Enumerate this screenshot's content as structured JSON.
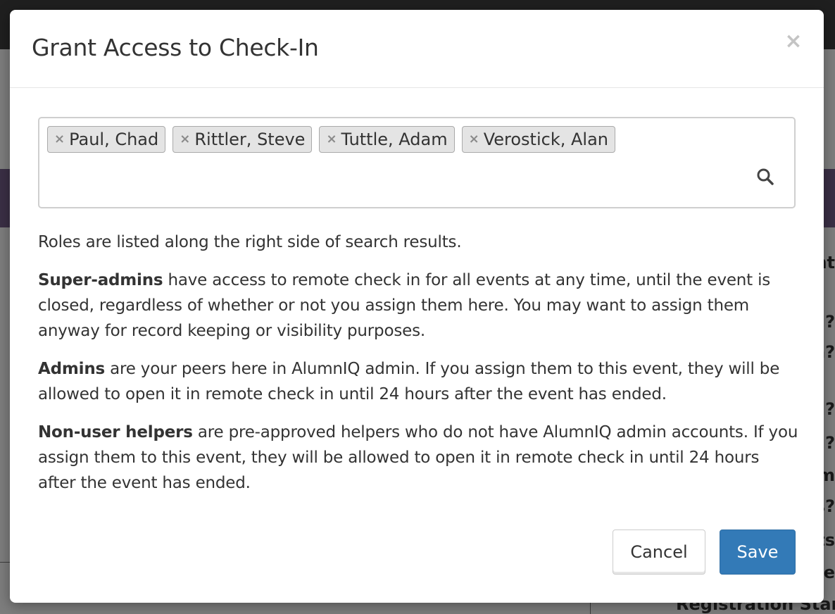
{
  "modal": {
    "title": "Grant Access to Check-In",
    "close_symbol": "×"
  },
  "selected_users": [
    {
      "remove_symbol": "×",
      "label": "Paul, Chad"
    },
    {
      "remove_symbol": "×",
      "label": "Rittler, Steve"
    },
    {
      "remove_symbol": "×",
      "label": "Tuttle, Adam"
    },
    {
      "remove_symbol": "×",
      "label": "Verostick, Alan"
    }
  ],
  "search": {
    "icon": "search-icon"
  },
  "info": {
    "intro": "Roles are listed along the right side of search results.",
    "super_admins_term": "Super-admins",
    "super_admins_text": " have access to remote check in for all events at any time, until the event is closed, regardless of whether or not you assign them here. You may want to assign them anyway for record keeping or visibility purposes.",
    "admins_term": "Admins",
    "admins_text": " are your peers here in AlumnIQ admin. If you assign them to this event, they will be allowed to open it in remote check in until 24 hours after the event has ended.",
    "helpers_term": "Non-user helpers",
    "helpers_text": " are pre-approved helpers who do not have AlumnIQ admin accounts. If you assign them to this event, they will be allowed to open it in remote check in until 24 hours after the event has ended."
  },
  "footer": {
    "cancel_label": "Cancel",
    "save_label": "Save"
  },
  "background": {
    "fragments": [
      "nt",
      "g?",
      "n?",
      "d?",
      "g?",
      "m",
      "s?",
      "ts",
      "e"
    ],
    "bottom_text": "Registration Start"
  },
  "colors": {
    "primary": "#337ab7",
    "chip_bg": "#e4e4e4",
    "overlay": "#7d7d7d"
  }
}
